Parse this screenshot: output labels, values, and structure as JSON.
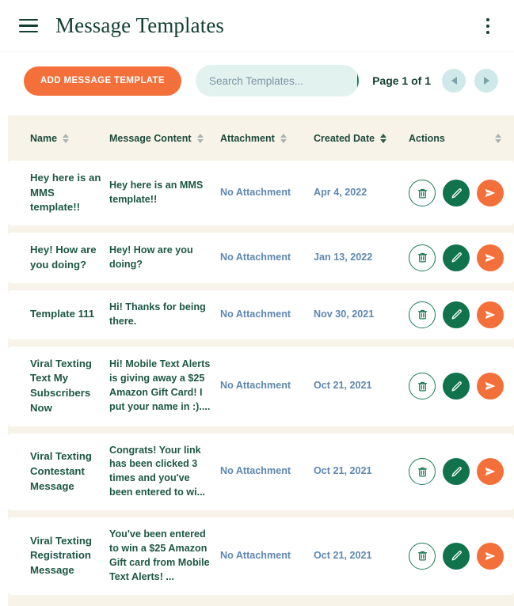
{
  "header": {
    "menu_icon": "hamburger-icon",
    "title": "Message Templates",
    "overflow_icon": "kebab-menu-icon"
  },
  "toolbar": {
    "add_label": "ADD MESSAGE TEMPLATE",
    "search_placeholder": "Search Templates...",
    "search_value": "",
    "search_icon": "search-icon",
    "page_label": "Page 1 of 1",
    "prev_icon": "chevron-left-icon",
    "next_icon": "chevron-right-icon"
  },
  "table": {
    "columns": [
      {
        "label": "Name",
        "sorted": false
      },
      {
        "label": "Message Content",
        "sorted": false
      },
      {
        "label": "Attachment",
        "sorted": false
      },
      {
        "label": "Created Date",
        "sorted": true
      },
      {
        "label": "Actions",
        "sorted": false
      }
    ],
    "rows": [
      {
        "name": "Hey here is an MMS template!!",
        "content": "Hey here is an MMS template!!",
        "attachment": "No Attachment",
        "created": "Apr 4, 2022"
      },
      {
        "name": "Hey! How are you doing?",
        "content": "Hey! How are you doing?",
        "attachment": "No Attachment",
        "created": "Jan 13, 2022"
      },
      {
        "name": "Template 111",
        "content": "Hi! Thanks for being there.",
        "attachment": "No Attachment",
        "created": "Nov 30, 2021"
      },
      {
        "name": "Viral Texting Text My Subscribers Now",
        "content": "Hi! Mobile Text Alerts is giving away a $25 Amazon Gift Card! I put your name in :)....",
        "attachment": "No Attachment",
        "created": "Oct 21, 2021"
      },
      {
        "name": "Viral Texting Contestant Message",
        "content": "Congrats! Your link has been clicked 3 times and you've been entered to wi...",
        "attachment": "No Attachment",
        "created": "Oct 21, 2021"
      },
      {
        "name": "Viral Texting Registration Message",
        "content": "You've been entered to win a $25 Amazon Gift card from Mobile Text Alerts! ...",
        "attachment": "No Attachment",
        "created": "Oct 21, 2021"
      }
    ],
    "actions": {
      "delete_icon": "trash-icon",
      "edit_icon": "pencil-icon",
      "send_icon": "send-icon"
    }
  },
  "colors": {
    "accent_orange": "#f4703a",
    "accent_green": "#10734c",
    "dark_green": "#123f32",
    "panel_cream": "#f8f3e8",
    "link_blue": "#5f87b3",
    "mint": "#e2f3ef"
  }
}
